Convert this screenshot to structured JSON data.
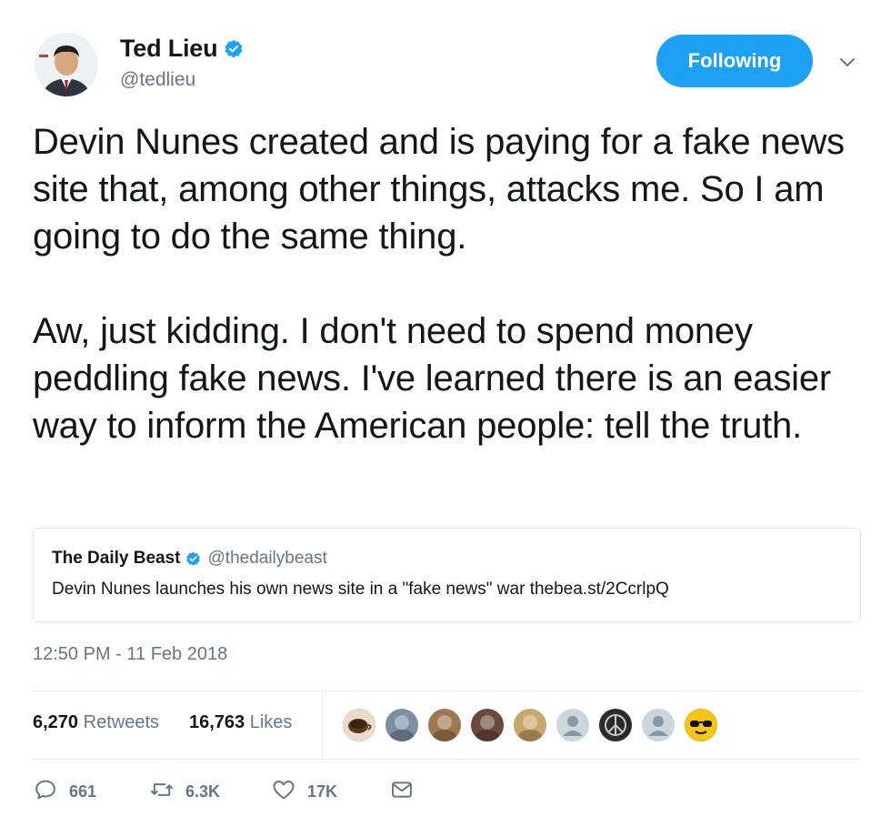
{
  "author": {
    "name": "Ted Lieu",
    "handle": "@tedlieu",
    "verified": true
  },
  "follow_button": {
    "label": "Following"
  },
  "tweet": {
    "paragraphs": [
      "Devin Nunes created and is paying for a fake news site that, among other things, attacks me. So I am going to do the same thing.",
      "Aw, just kidding. I don't need to spend money peddling fake news. I've learned there is an easier way to inform the American people: tell the truth."
    ]
  },
  "quoted_tweet": {
    "name": "The Daily Beast",
    "handle": "@thedailybeast",
    "text": "Devin Nunes launches his own news site in a \"fake news\" war thebea.st/2CcrlpQ"
  },
  "timestamp": "12:50 PM - 11 Feb 2018",
  "stats": {
    "retweets_count": "6,270",
    "retweets_label": "Retweets",
    "likes_count": "16,763",
    "likes_label": "Likes"
  },
  "liked_by_avatars": [
    {
      "icon": "coffee-cup-avatar",
      "color": "#8a5a3a"
    },
    {
      "icon": "cat-avatar",
      "color": "#7d8fa3"
    },
    {
      "icon": "cat-avatar",
      "color": "#a07850"
    },
    {
      "icon": "photo-avatar",
      "color": "#6b4a3a"
    },
    {
      "icon": "flowers-avatar",
      "color": "#c9a66b"
    },
    {
      "icon": "default-person-avatar",
      "color": "#ccd6dd"
    },
    {
      "icon": "peace-sign-avatar",
      "color": "#2b2b2b"
    },
    {
      "icon": "default-person-avatar",
      "color": "#ccd6dd"
    },
    {
      "icon": "sunglasses-avatar",
      "color": "#f0b400"
    }
  ],
  "actions": {
    "reply_count": "661",
    "retweet_count": "6.3K",
    "like_count": "17K"
  },
  "colors": {
    "accent": "#1da1f2",
    "text": "#14171a",
    "muted": "#657786",
    "border": "#e1e8ed"
  }
}
